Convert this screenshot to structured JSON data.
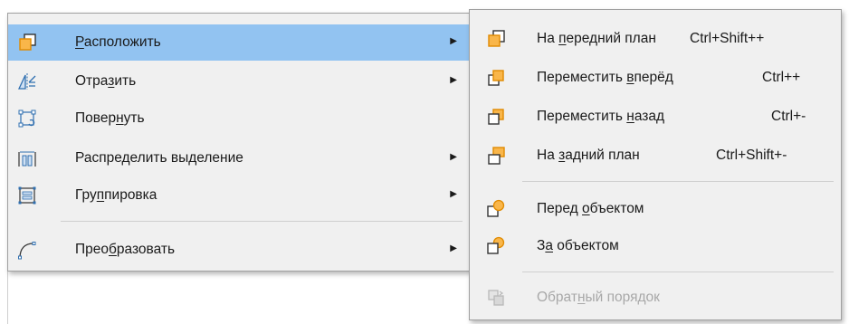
{
  "main_menu": {
    "items": [
      {
        "pre": "",
        "u": "Р",
        "post": "асположить",
        "icon": "arrange-icon",
        "submenu": true,
        "highlighted": true
      },
      {
        "pre": "Отра",
        "u": "з",
        "post": "ить",
        "icon": "flip-icon",
        "submenu": true
      },
      {
        "pre": "Повер",
        "u": "н",
        "post": "уть",
        "icon": "rotate-icon",
        "submenu": false
      },
      {
        "pre": "Распре",
        "u": "д",
        "post": "елить выделение",
        "icon": "distribute-icon",
        "submenu": true
      },
      {
        "pre": "Гру",
        "u": "п",
        "post": "пировка",
        "icon": "group-icon",
        "submenu": true
      },
      {
        "pre": "Прео",
        "u": "б",
        "post": "разовать",
        "icon": "convert-icon",
        "submenu": true
      }
    ],
    "arrow": "▶"
  },
  "sub_menu": {
    "items": [
      {
        "pre": "На ",
        "u": "п",
        "post": "ередний план",
        "accel": "Ctrl+Shift++",
        "icon": "bring-to-front-icon"
      },
      {
        "pre": "Переместить ",
        "u": "в",
        "post": "перёд",
        "accel": "Ctrl++",
        "icon": "bring-forward-icon"
      },
      {
        "pre": "Переместить ",
        "u": "н",
        "post": "азад",
        "accel": "Ctrl+-",
        "icon": "send-backward-icon"
      },
      {
        "pre": "На ",
        "u": "з",
        "post": "адний план",
        "accel": "Ctrl+Shift+-",
        "icon": "send-to-back-icon"
      },
      {
        "pre": "Перед ",
        "u": "о",
        "post": "бъектом",
        "accel": "",
        "icon": "in-front-of-object-icon"
      },
      {
        "pre": "З",
        "u": "а",
        "post": " объектом",
        "accel": "",
        "icon": "behind-object-icon"
      },
      {
        "pre": "Обрат",
        "u": "н",
        "post": "ый порядок",
        "accel": "",
        "icon": "reverse-order-icon",
        "disabled": true
      }
    ]
  },
  "colors": {
    "highlight": "#92c3f1",
    "menu_bg": "#f0f0f0",
    "icon_orange": "#f5a623",
    "icon_blue": "#2f6fb0",
    "disabled_text": "#a8a8a8"
  }
}
